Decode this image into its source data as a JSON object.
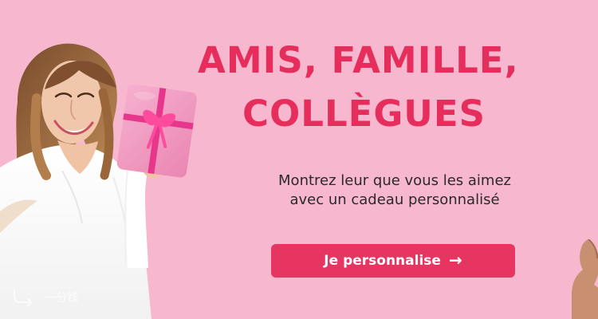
{
  "banner": {
    "headline": {
      "line_1": "AMIS, FAMILLE,",
      "line_2": "COLLÈGUES"
    },
    "subtitle": {
      "line_1": "Montrez leur que vous les aimez",
      "line_2": "avec un cadeau personnalisé"
    },
    "cta": {
      "label": "Je personnalise",
      "icon": "arrow-right-icon",
      "arrow_glyph": "→"
    },
    "watermark": {
      "text": "一分钱",
      "icon": "watermark-logo-icon"
    },
    "colors": {
      "background": "#f7b8cf",
      "accent": "#e62e5c",
      "button": "#e73561",
      "body_text": "#2a2a2a"
    }
  }
}
